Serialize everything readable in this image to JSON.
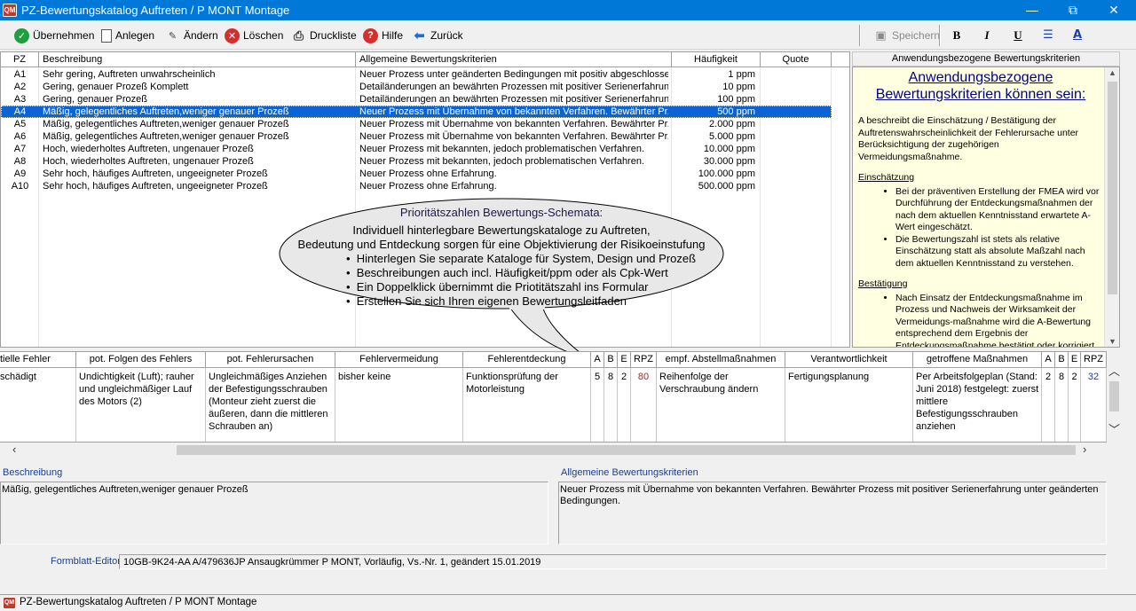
{
  "window": {
    "title": "PZ-Bewertungskatalog Auftreten / P MONT Montage",
    "icon_text": "QM",
    "controls": {
      "minimize": "—",
      "restore": "⧉",
      "close": "✕"
    }
  },
  "toolbar": {
    "uebernehmen": "Übernehmen",
    "anlegen": "Anlegen",
    "aendern": "Ändern",
    "loeschen": "Löschen",
    "druckliste": "Druckliste",
    "hilfe": "Hilfe",
    "zurueck": "Zurück",
    "speichern": "Speichern",
    "bold": "B",
    "italic": "I",
    "underline": "U",
    "list": "☰",
    "font_color": "A"
  },
  "catalog": {
    "columns": [
      "PZ",
      "Beschreibung",
      "Allgemeine Bewertungskriterien",
      "Häufigkeit",
      "Quote"
    ],
    "rows": [
      {
        "pz": "A1",
        "beschreibung": "Sehr gering, Auftreten unwahrscheinlich",
        "kriterien": "Neuer Prozess unter geänderten Bedingungen mit positiv abgeschlosse...",
        "haeufigkeit": "1 ppm",
        "quote": ""
      },
      {
        "pz": "A2",
        "beschreibung": "Gering, genauer Prozeß Komplett",
        "kriterien": "Detailänderungen an bewährten Prozessen mit positiver Serienerfahrun...",
        "haeufigkeit": "10 ppm",
        "quote": ""
      },
      {
        "pz": "A3",
        "beschreibung": "Gering, genauer Prozeß",
        "kriterien": "Detailänderungen an bewährten Prozessen mit positiver Serienerfahrun...",
        "haeufigkeit": "100 ppm",
        "quote": ""
      },
      {
        "pz": "A4",
        "beschreibung": "Mäßig, gelegentliches Auftreten,weniger genauer Prozeß",
        "kriterien": "Neuer Prozess mit Übernahme von bekannten Verfahren. Bewährter Pr...",
        "haeufigkeit": "500 ppm",
        "quote": ""
      },
      {
        "pz": "A5",
        "beschreibung": "Mäßig, gelegentliches Auftreten,weniger genauer Prozeß",
        "kriterien": "Neuer Prozess mit Übernahme von bekannten Verfahren. Bewährter Pr...",
        "haeufigkeit": "2.000 ppm",
        "quote": ""
      },
      {
        "pz": "A6",
        "beschreibung": "Mäßig, gelegentliches Auftreten,weniger genauer Prozeß",
        "kriterien": "Neuer Prozess mit Übernahme von bekannten Verfahren. Bewährter Pr...",
        "haeufigkeit": "5.000 ppm",
        "quote": ""
      },
      {
        "pz": "A7",
        "beschreibung": "Hoch, wiederholtes Auftreten, ungenauer Prozeß",
        "kriterien": "Neuer Prozess mit bekannten, jedoch problematischen Verfahren.",
        "haeufigkeit": "10.000 ppm",
        "quote": ""
      },
      {
        "pz": "A8",
        "beschreibung": "Hoch, wiederholtes Auftreten, ungenauer Prozeß",
        "kriterien": "Neuer Prozess mit bekannten, jedoch problematischen Verfahren.",
        "haeufigkeit": "30.000 ppm",
        "quote": ""
      },
      {
        "pz": "A9",
        "beschreibung": "Sehr hoch, häufiges Auftreten, ungeeigneter Prozeß",
        "kriterien": "Neuer Prozess ohne Erfahrung.",
        "haeufigkeit": "100.000 ppm",
        "quote": ""
      },
      {
        "pz": "A10",
        "beschreibung": "Sehr hoch, häufiges Auftreten, ungeeigneter Prozeß",
        "kriterien": "Neuer Prozess ohne Erfahrung.",
        "haeufigkeit": "500.000 ppm",
        "quote": ""
      }
    ],
    "selected_index": 3
  },
  "callout": {
    "title": "Prioritätszahlen Bewertungs-Schemata:",
    "line1": "Individuell hinterlegbare Bewertungskataloge zu Auftreten,",
    "line2": "Bedeutung und Entdeckung sorgen für eine Objektivierung der Risikoeinstufung",
    "bullets": [
      "Hinterlegen Sie separate Kataloge für System, Design und Prozeß",
      "Beschreibungen auch incl. Häufigkeit/ppm oder als Cpk-Wert",
      "Ein Doppelklick übernimmt die Priotitätszahl ins Formular",
      "Erstellen Sie sich Ihren eigenen Bewertungsleitfaden"
    ]
  },
  "right_panel": {
    "header": "Anwendungsbezogene Bewertungskriterien",
    "title": "Anwendungsbezogene Bewertungskriterien können sein:",
    "intro": "A beschreibt die Einschätzung / Bestätigung der Auftretenswahrscheinlichkeit der Fehlerursache unter Berücksichtigung der zugehörigen Vermeidungsmaßnahme.",
    "sec1_title": "Einschätzung",
    "sec1_items": [
      "Bei der präventiven Erstellung der FMEA wird vor Durchführung der Entdeckungsmaßnahmen der nach dem aktuellen Kenntnisstand erwartete A-Wert eingeschätzt.",
      "Die Bewertungszahl ist stets als relative Einschätzung statt als absolute Maßzahl nach dem aktuellen Kenntnisstand zu verstehen."
    ],
    "sec2_title": "Bestätigung",
    "sec2_items": [
      "Nach Einsatz der Entdeckungsmaßnahme im Prozess und Nachweis der Wirksamkeit der Vermeidungs-maßnahme wird die A-Bewertung entsprechend dem Ergebnis der Entdeckungsmaßnahme bestätigt oder korrigiert."
    ]
  },
  "fmea": {
    "headers": {
      "fehler": "tielle Fehler",
      "folgen": "pot. Folgen des Fehlers",
      "ursachen": "pot. Fehlerursachen",
      "vermeidung": "Fehlervermeidung",
      "entdeckung": "Fehlerentdeckung",
      "a": "A",
      "b": "B",
      "e": "E",
      "rpz": "RPZ",
      "abstell": "empf. Abstellmaßnahmen",
      "verantwortlich": "Verantwortlichkeit",
      "getroffen": "getroffene Maßnahmen",
      "a2": "A",
      "b2": "B",
      "e2": "E",
      "rpz2": "RPZ"
    },
    "row": {
      "fehler": "schädigt",
      "folgen": "Undichtigkeit (Luft); rauher und ungleichmäßiger Lauf des Motors (2)",
      "ursachen": "Ungleichmäßiges Anziehen der Befestigungsschrauben (Monteur zieht zuerst die äußeren, dann die mittleren Schrauben an)",
      "vermeidung": "bisher keine",
      "entdeckung": "Funktionsprüfung der Motorleistung",
      "a": "5",
      "b": "8",
      "e": "2",
      "rpz": "80",
      "abstell": "Reihenfolge der Verschraubung ändern",
      "verantwortlich": "Fertigungsplanung",
      "getroffen": "Per Arbeitsfolgeplan (Stand: Juni 2018) festgelegt: zuerst mittlere Befestigungsschrauben anziehen",
      "a2": "2",
      "b2": "8",
      "e2": "2",
      "rpz2": "32"
    },
    "colors": {
      "rpz": "#b22222",
      "rpz2": "#1f3fa8"
    }
  },
  "details": {
    "beschreibung_label": "Beschreibung",
    "beschreibung_value": "Mäßig, gelegentliches Auftreten,weniger genauer Prozeß",
    "kriterien_label": "Allgemeine Bewertungskriterien",
    "kriterien_value": "Neuer Prozess mit Übernahme von bekannten Verfahren. Bewährter Prozess mit positiver Serienerfahrung unter geänderten Bedingungen."
  },
  "footer": {
    "editor_label": "Formblatt-Editor",
    "editor_value": "10GB-9K24-AA  A/479636JP  Ansaugkrümmer  P  MONT, Vorläufig, Vs.-Nr. 1, geändert  15.01.2019",
    "taskbar_title": "PZ-Bewertungskatalog Auftreten / P MONT Montage"
  }
}
